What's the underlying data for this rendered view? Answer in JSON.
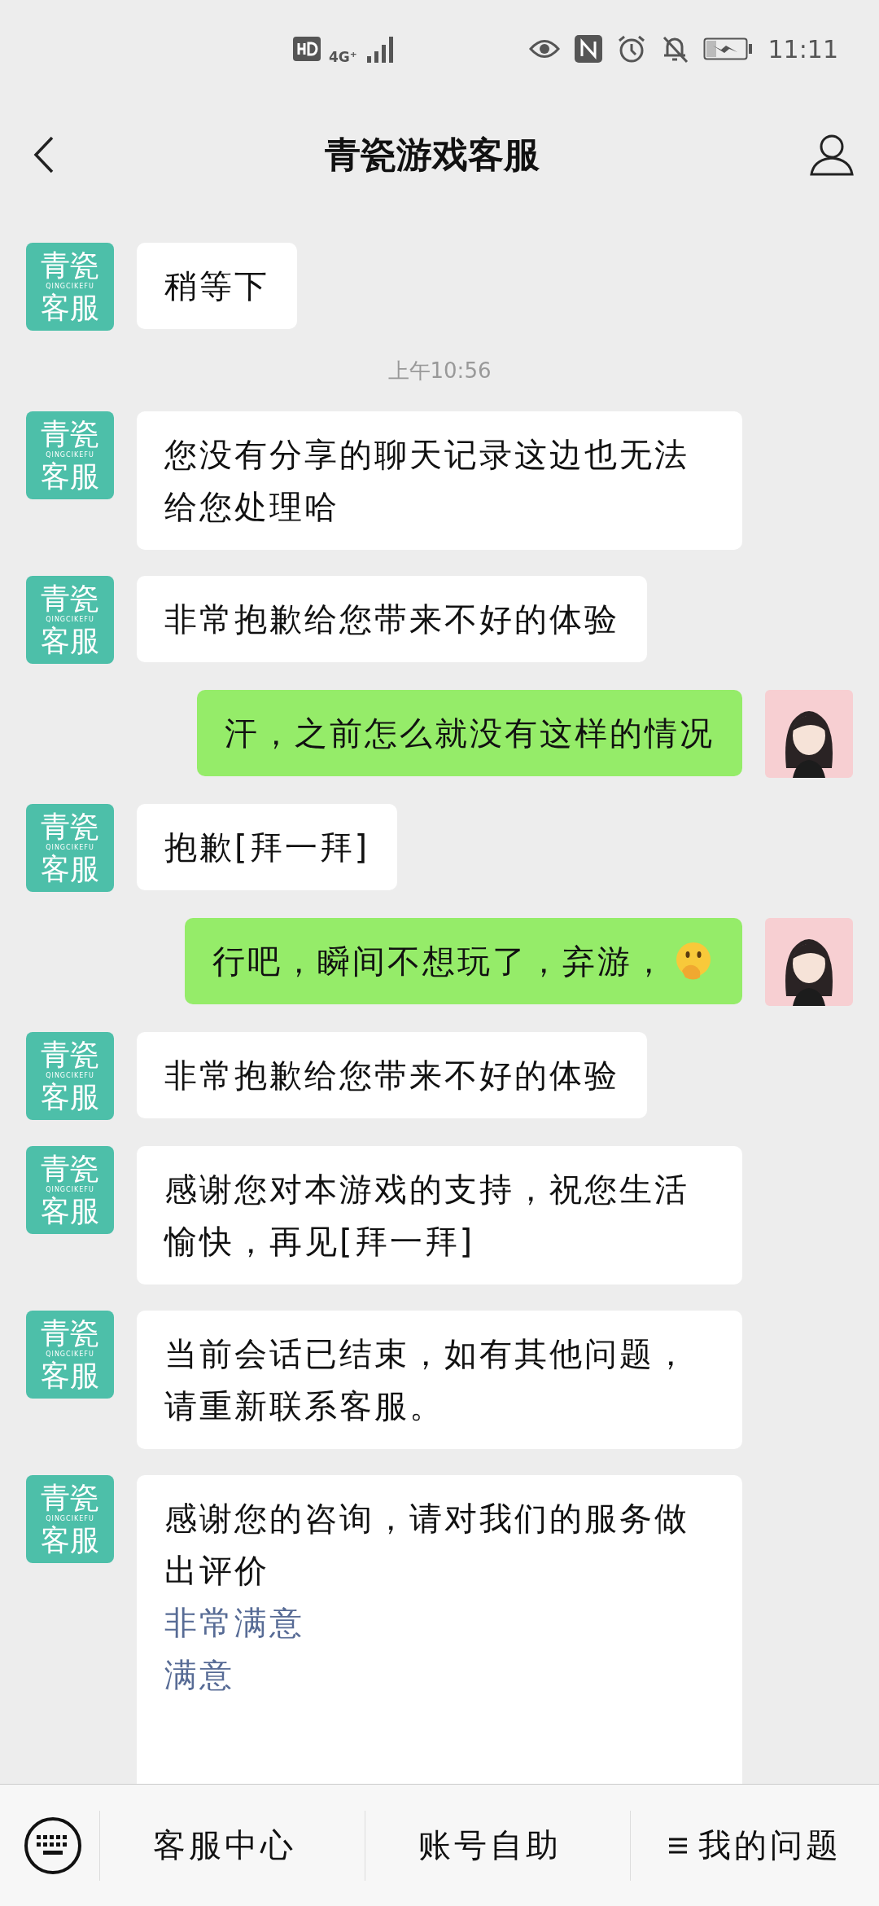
{
  "status_bar": {
    "network": "4G⁺",
    "time": "11:11"
  },
  "header": {
    "title": "青瓷游戏客服"
  },
  "messages": [
    {
      "kind": "agent",
      "avatar": {
        "top": "青瓷",
        "tagline": "QINGCIKEFU",
        "bottom": "客服"
      },
      "text": "稍等下"
    },
    {
      "kind": "time",
      "text": "上午10:56"
    },
    {
      "kind": "agent",
      "avatar": {
        "top": "青瓷",
        "tagline": "QINGCIKEFU",
        "bottom": "客服"
      },
      "text": "您没有分享的聊天记录这边也无法给您处理哈"
    },
    {
      "kind": "agent",
      "avatar": {
        "top": "青瓷",
        "tagline": "QINGCIKEFU",
        "bottom": "客服"
      },
      "text": "非常抱歉给您带来不好的体验"
    },
    {
      "kind": "user",
      "text": "汗，之前怎么就没有这样的情况",
      "emoji": false
    },
    {
      "kind": "agent",
      "avatar": {
        "top": "青瓷",
        "tagline": "QINGCIKEFU",
        "bottom": "客服"
      },
      "text": "抱歉[拜一拜]"
    },
    {
      "kind": "user",
      "text": "行吧，瞬间不想玩了，弃游，",
      "emoji": true
    },
    {
      "kind": "agent",
      "avatar": {
        "top": "青瓷",
        "tagline": "QINGCIKEFU",
        "bottom": "客服"
      },
      "text": "非常抱歉给您带来不好的体验"
    },
    {
      "kind": "agent",
      "avatar": {
        "top": "青瓷",
        "tagline": "QINGCIKEFU",
        "bottom": "客服"
      },
      "text": "感谢您对本游戏的支持，祝您生活愉快，再见[拜一拜]"
    },
    {
      "kind": "agent",
      "avatar": {
        "top": "青瓷",
        "tagline": "QINGCIKEFU",
        "bottom": "客服"
      },
      "text": "当前会话已结束，如有其他问题，请重新联系客服。"
    },
    {
      "kind": "agent",
      "avatar": {
        "top": "青瓷",
        "tagline": "QINGCIKEFU",
        "bottom": "客服"
      },
      "text": "感谢您的咨询，请对我们的服务做出评价",
      "links": [
        "非常满意",
        "满意"
      ]
    }
  ],
  "bottom_bar": {
    "menus": [
      {
        "label": "客服中心",
        "icon": false
      },
      {
        "label": "账号自助",
        "icon": false
      },
      {
        "label": "我的问题",
        "icon": true
      }
    ]
  }
}
